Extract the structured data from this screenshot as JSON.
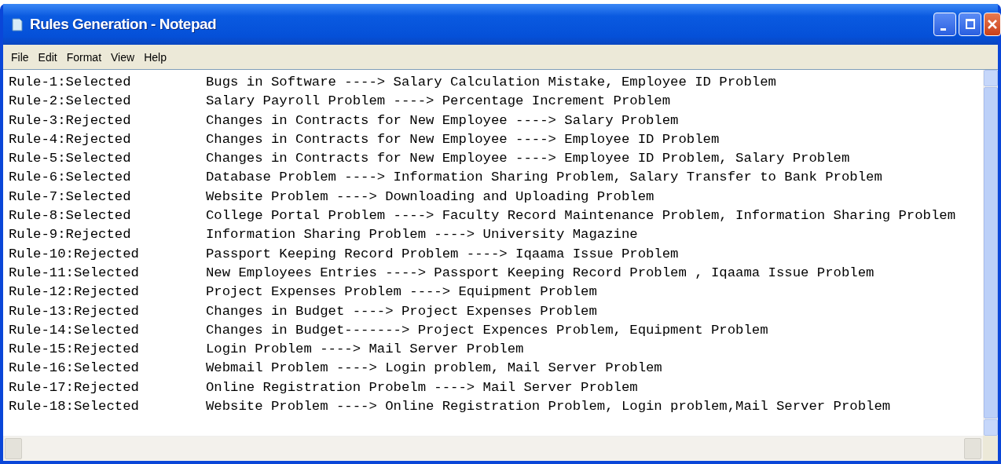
{
  "window": {
    "title": "Rules Generation - Notepad"
  },
  "menu": [
    "File",
    "Edit",
    "Format",
    "View",
    "Help"
  ],
  "lines": [
    {
      "label": "Rule-1:Selected",
      "rule": "Bugs in Software ----> Salary Calculation Mistake, Employee ID Problem"
    },
    {
      "label": "Rule-2:Selected",
      "rule": "Salary Payroll Problem ----> Percentage Increment Problem"
    },
    {
      "label": "Rule-3:Rejected",
      "rule": "Changes in Contracts for New Employee ----> Salary Problem"
    },
    {
      "label": "Rule-4:Rejected",
      "rule": "Changes in Contracts for New Employee ----> Employee ID Problem"
    },
    {
      "label": "Rule-5:Selected",
      "rule": "Changes in Contracts for New Employee ----> Employee ID Problem, Salary Problem"
    },
    {
      "label": "Rule-6:Selected",
      "rule": "Database Problem ----> Information Sharing Problem, Salary Transfer to Bank Problem"
    },
    {
      "label": "Rule-7:Selected",
      "rule": "Website Problem ----> Downloading and Uploading Problem"
    },
    {
      "label": "Rule-8:Selected",
      "rule": "College Portal Problem ----> Faculty Record Maintenance Problem, Information Sharing Problem"
    },
    {
      "label": "Rule-9:Rejected",
      "rule": "Information Sharing Problem ----> University Magazine"
    },
    {
      "label": "Rule-10:Rejected",
      "rule": "Passport Keeping Record Problem ----> Iqaama Issue Problem"
    },
    {
      "label": "Rule-11:Selected",
      "rule": "New Employees Entries ----> Passport Keeping Record Problem , Iqaama Issue Problem"
    },
    {
      "label": "Rule-12:Rejected",
      "rule": "Project Expenses Problem ----> Equipment Problem"
    },
    {
      "label": "Rule-13:Rejected",
      "rule": "Changes in Budget ----> Project Expenses Problem"
    },
    {
      "label": "Rule-14:Selected",
      "rule": "Changes in Budget-------> Project Expences Problem, Equipment Problem"
    },
    {
      "label": "Rule-15:Rejected",
      "rule": "Login Problem ----> Mail Server Problem"
    },
    {
      "label": "Rule-16:Selected",
      "rule": "Webmail Problem ----> Login problem, Mail Server Problem"
    },
    {
      "label": "Rule-17:Rejected",
      "rule": "Online Registration Probelm ----> Mail Server Problem"
    },
    {
      "label": "Rule-18:Selected",
      "rule": "Website Problem ----> Online Registration Problem, Login problem,Mail Server Problem"
    }
  ]
}
